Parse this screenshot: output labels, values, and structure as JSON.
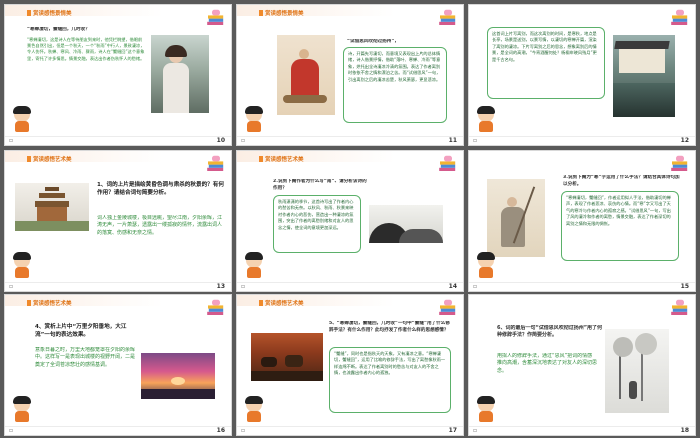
{
  "slides": [
    {
      "num": "10",
      "header": "赏读感悟景情美",
      "question": "“寒蝉凄切，蟹缝回，几时收？",
      "answer": "“寒蝉凄切，这是诗人在等待朋友到来时，他凭栏眺望，借眼前景色自然引出，但是一个秋天，一个“秋雨”中行人，景致凄凉，令人伤怀。秋蝉、寒风、冷雨、骤雨，诗人在“蟹缝回”这个意象里，寄托了许多情思。情景交融，表达出作者伤秋怀人的愁绪。"
    },
    {
      "num": "11",
      "header": "赏读感悟景情美",
      "question": "“试借思风吹彻过扬州”，",
      "answer": "诗，开篇先写凄切，而意境又表现出上片的总体情绪，诗人借景抒情，借助“落叶、寒蝉、冷雨”等意象，烘托出全诗凄凉冷清的氛围。表达了作者离别时依依不舍之情和漂泊之苦。而“试借思风”一句，引出离别之后的凄凉苦楚，秋风萧瑟，更显悲凉。"
    },
    {
      "num": "12",
      "header": "",
      "question": "",
      "answer": "这首词上片写离别，而这次离别的时间，是寒秋，地点是长亭，场景是送别，以景写情，以凄切的寒蝉开篇，渲染了离别的凄凉。下片写离别之后的思念，想象离别后的情景，是全词的高潮，“今宵酒醒何处？杨柳岸晓风残月”更是千古名句。"
    },
    {
      "num": "13",
      "header": "赏读感悟艺术美",
      "question": "1、词的上片是描绘黄昏色调与肃杀的秋景的？有何作用？请结合词句简要分析。",
      "answer": "词人独上金陵城楼，极目远眺，望尽江南，夕阳余晖，江涛无声，一片萧瑟，透露出一缕孤寂的情怀，流露出词人的落寞、伤感和无奈之情。"
    },
    {
      "num": "14",
      "header": "赏读感悟艺术美",
      "question": "2.说到下阙作者为什么写“南”、请分析该诗的作用？",
      "answer": "秋雨潇潇的季节，这首诗写出了作者内心的愁苦和无奈。以秋风、秋雨、秋景来映衬作者内心的悲伤，营造出一种凄凉的氛围，突出了作者的离愁别绪和对友人的思念之情，使全词的意境更加深远。"
    },
    {
      "num": "15",
      "header": "",
      "question": "3.说到下阙为“寒”字运用了什么手法？请结合具体诗句加以分析。",
      "answer": "“寒蝉凄切，蟹缝回”，作者运用拟人手法，借助凄切的蝉声，表现了作者悲凉、哀伤的心情。而“寒”字又写出了天气的寒冷与作者内心的孤寂之感。“试借思风”一句，写出了风的凄冷和作者的离愁，情景交融，表达了作者深切的离别之情和无限的惆怅。"
    },
    {
      "num": "16",
      "header": "赏读感悟艺术美",
      "question": "4、赏析上片中“万里夕阳垂地，大江流”一句的表达效果。",
      "answer": "意象日暮之时，万里大地都笼罩在夕阳的余晖中。这样写一是表现出城楼的视野开阔，二是奠定了全词苍凉悲壮的感情基调。"
    },
    {
      "num": "17",
      "header": "赏读感悟艺术美",
      "question": "5、“寒蝉凄切，蟹缝回，几时收”一句中“蟹缝”用了什么修辞手法？有什么作用？此句抒发了作者什么样的思想感情？",
      "answer": "“蟹缝”，同时也是指秋天的天象，又有凄凉之意。“寒蝉凄切，蟹缝回”，运用了比喻的修辞手法，写出了离愁像秋雨一样连绵不断。表达了作者离别时的愁苦与对友人的不舍之情，也流露出作者内心的孤独。"
    },
    {
      "num": "18",
      "header": "",
      "question": "6、词的最后一句“试借思风吹彻过扬州”用了何种修辞手法？作简要分析。",
      "answer": "用拟人的修辞手法，通过“思风”把词的情感推向高潮，含蓄深沉地表达了对友人的深切思念。"
    }
  ],
  "footer_icon": "pager-icon"
}
